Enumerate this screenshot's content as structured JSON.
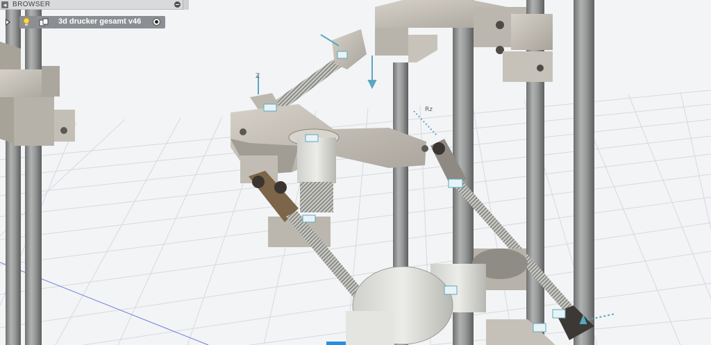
{
  "browser": {
    "title": "BROWSER",
    "root_component": {
      "name": "3d drucker gesamt v46",
      "expanded": false,
      "visible_icon": "lightbulb-icon",
      "type_icon": "component-icon",
      "active_icon": "radio-active-icon"
    }
  },
  "viewport": {
    "background": "#f3f4f6",
    "grid_color": "#d6d9dd",
    "model_color": "#bab5ad",
    "rod_color": "#8c8d8d",
    "joint_glyph_color": "#5aa7c0"
  }
}
